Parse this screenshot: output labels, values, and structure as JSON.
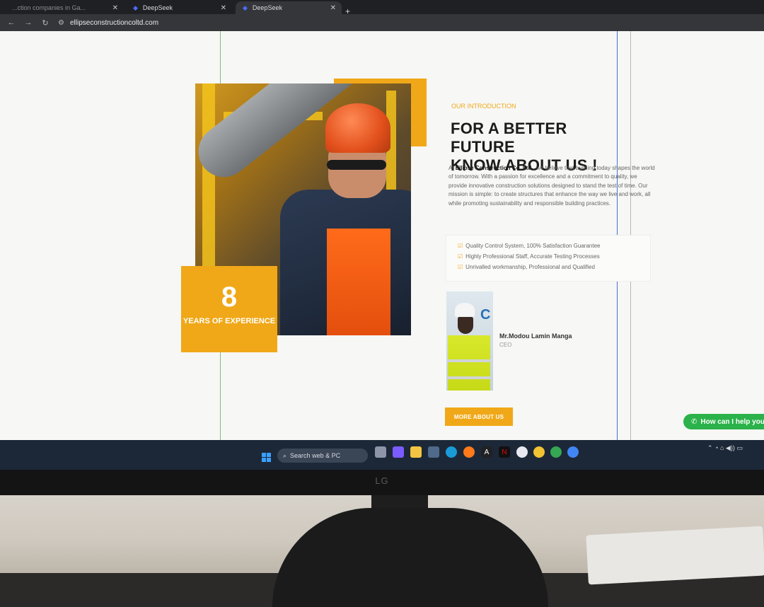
{
  "browser": {
    "tabs": [
      {
        "label": "...ction companies in Ga...",
        "active": false
      },
      {
        "label": "DeepSeek",
        "active": false
      },
      {
        "label": "DeepSeek",
        "active": true
      }
    ],
    "new_tab_label": "+",
    "url": "ellipseconstructioncoltd.com"
  },
  "hero": {
    "years_number": "8",
    "years_text": "YEARS OF EXPERIENCE"
  },
  "intro": {
    "label": "OUR INTRODUCTION",
    "headline_line1": "FOR A BETTER FUTURE",
    "headline_line2": "KNOW ABOUT US !",
    "desc_prefix": "At ",
    "company": "Ellipse Construction Co. Ltd.",
    "desc_body": ", we believe that building today shapes the world of tomorrow. With a passion for excellence and a commitment to quality, we provide innovative construction solutions designed to stand the test of time. Our mission is simple: to create structures that enhance the way we live and work, all while promoting sustainability and responsible building practices."
  },
  "features": [
    "Quality Control System, 100% Satisfaction Guarantee",
    "Highly Professional Staff, Accurate Testing Processes",
    "Unrivalled workmanship, Professional and Qualified"
  ],
  "ceo": {
    "name": "Mr.Modou Lamin Manga",
    "role": "CEO"
  },
  "more_button": "MORE ABOUT US",
  "whatsapp": "How can I help you",
  "taskbar": {
    "search_placeholder": "Search web & PC"
  },
  "monitor_brand": "LG",
  "colors": {
    "accent": "#f0a818",
    "whatsapp": "#2bb24a"
  }
}
